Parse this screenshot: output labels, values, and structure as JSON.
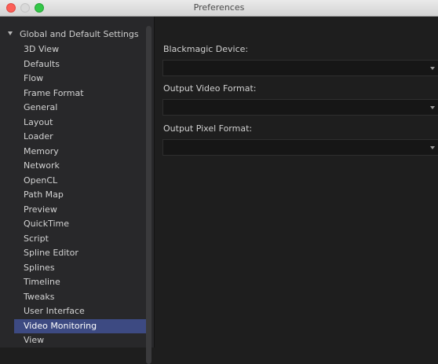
{
  "window": {
    "title": "Preferences"
  },
  "sidebar": {
    "root_label": "Global and Default Settings",
    "items": [
      {
        "label": "3D View"
      },
      {
        "label": "Defaults"
      },
      {
        "label": "Flow"
      },
      {
        "label": "Frame Format"
      },
      {
        "label": "General"
      },
      {
        "label": "Layout"
      },
      {
        "label": "Loader"
      },
      {
        "label": "Memory"
      },
      {
        "label": "Network"
      },
      {
        "label": "OpenCL"
      },
      {
        "label": "Path Map"
      },
      {
        "label": "Preview"
      },
      {
        "label": "QuickTime"
      },
      {
        "label": "Script"
      },
      {
        "label": "Spline Editor"
      },
      {
        "label": "Splines"
      },
      {
        "label": "Timeline"
      },
      {
        "label": "Tweaks"
      },
      {
        "label": "User Interface"
      },
      {
        "label": "Video Monitoring"
      },
      {
        "label": "View"
      }
    ],
    "selected_label": "Video Monitoring"
  },
  "main": {
    "fields": [
      {
        "label": "Blackmagic Device:",
        "value": ""
      },
      {
        "label": "Output Video Format:",
        "value": ""
      },
      {
        "label": "Output Pixel Format:",
        "value": ""
      }
    ]
  },
  "colors": {
    "selection": "#3d4a82",
    "background": "#1e1e1e",
    "sidebar": "#28282a"
  }
}
